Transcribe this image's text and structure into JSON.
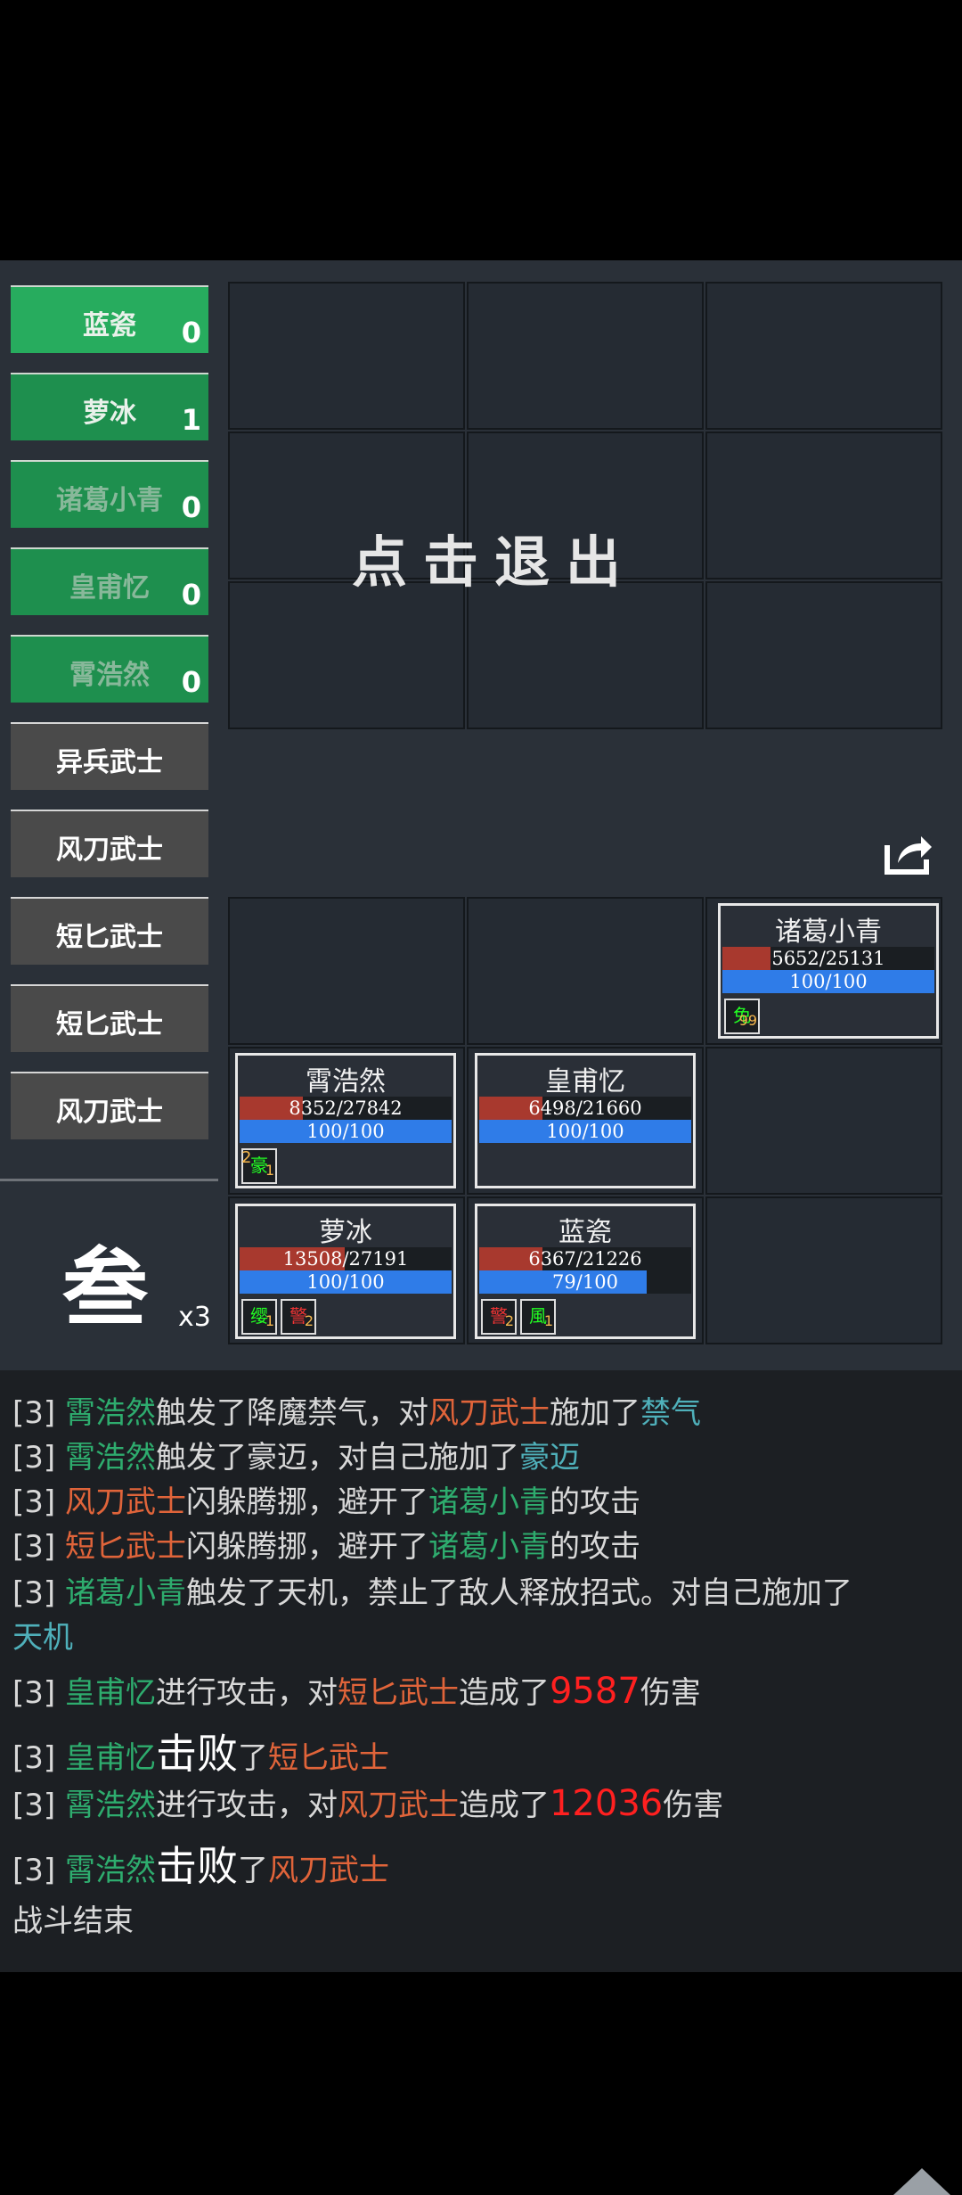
{
  "exit_label": "点击退出",
  "allies": [
    {
      "name": "蓝瓷",
      "count": "0"
    },
    {
      "name": "萝冰",
      "count": "1"
    },
    {
      "name": "诸葛小青",
      "count": "0"
    },
    {
      "name": "皇甫忆",
      "count": "0"
    },
    {
      "name": "霄浩然",
      "count": "0"
    }
  ],
  "enemies": [
    "异兵武士",
    "风刀武士",
    "短匕武士",
    "短匕武士",
    "风刀武士"
  ],
  "round": {
    "glyph": "叁",
    "multiplier": "x3"
  },
  "units": {
    "zhuge": {
      "name": "诸葛小青",
      "hp": "5652/25131",
      "mp": "100/100",
      "hp_frac": 0.225,
      "mp_frac": 1.0,
      "buffs": [
        {
          "icon": "免",
          "stack": "99"
        }
      ]
    },
    "xiaohaoran": {
      "name": "霄浩然",
      "hp": "8352/27842",
      "mp": "100/100",
      "hp_frac": 0.3,
      "mp_frac": 1.0,
      "buffs": [
        {
          "pre": "2",
          "icon": "豪",
          "stack": "1"
        }
      ]
    },
    "huangfuyi": {
      "name": "皇甫忆",
      "hp": "6498/21660",
      "mp": "100/100",
      "hp_frac": 0.3,
      "mp_frac": 1.0,
      "buffs": []
    },
    "luobing": {
      "name": "萝冰",
      "hp": "13508/27191",
      "mp": "100/100",
      "hp_frac": 0.497,
      "mp_frac": 1.0,
      "buffs": [
        {
          "icon": "缨",
          "stack": "1"
        },
        {
          "icon": "警",
          "stack": "2"
        }
      ]
    },
    "lanci": {
      "name": "蓝瓷",
      "hp": "6367/21226",
      "mp": "79/100",
      "hp_frac": 0.3,
      "mp_frac": 0.79,
      "buffs": [
        {
          "icon": "警",
          "stack": "2"
        },
        {
          "icon": "風",
          "stack": "1"
        }
      ]
    }
  },
  "log": {
    "l1": {
      "tag": "[3] ",
      "a": "霄浩然",
      "b": "触发了降魔禁气，对",
      "c": "风刀武士",
      "d": "施加了",
      "e": "禁气"
    },
    "l2": {
      "tag": "[3] ",
      "a": "霄浩然",
      "b": "触发了豪迈，对自己施加了",
      "e": "豪迈"
    },
    "l3": {
      "tag": "[3] ",
      "a": "风刀武士",
      "b": "闪躲腾挪，避开了",
      "c": "诸葛小青",
      "d": "的攻击"
    },
    "l4": {
      "tag": "[3] ",
      "a": "短匕武士",
      "b": "闪躲腾挪，避开了",
      "c": "诸葛小青",
      "d": "的攻击"
    },
    "l5": {
      "tag": "[3] ",
      "a": "诸葛小青",
      "b": "触发了天机，禁止了敌人释放招式。对自己施加了"
    },
    "l5b": "天机",
    "l6": {
      "tag": "[3] ",
      "a": "皇甫忆",
      "b": "进行攻击，对",
      "c": "短匕武士",
      "d": "造成了",
      "n": "9587",
      "e": "伤害"
    },
    "l7": {
      "tag": "[3] ",
      "a": "皇甫忆",
      "big": "击败",
      "b": "了",
      "c": "短匕武士"
    },
    "l8": {
      "tag": "[3] ",
      "a": "霄浩然",
      "b": "进行攻击，对",
      "c": "风刀武士",
      "d": "造成了",
      "n": "12036",
      "e": "伤害"
    },
    "l9": {
      "tag": "[3] ",
      "a": "霄浩然",
      "big": "击败",
      "b": "了",
      "c": "风刀武士"
    },
    "end": "战斗结束"
  }
}
